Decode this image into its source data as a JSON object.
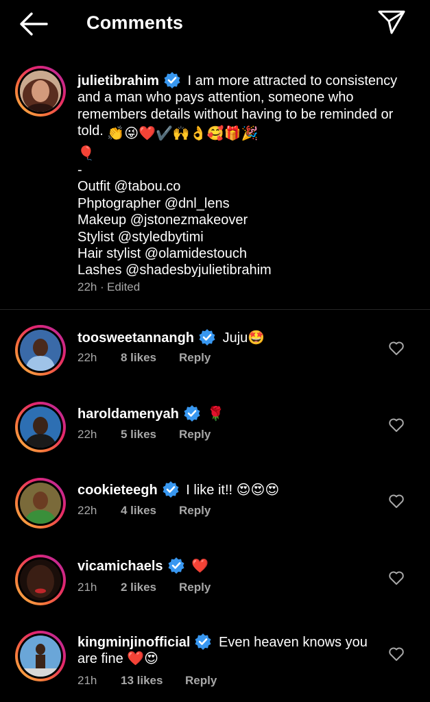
{
  "header": {
    "title": "Comments"
  },
  "caption": {
    "username": "julietibrahim",
    "text": "I am more attracted to consistency and a man who pays attention, someone who remembers details without having to be reminded or told.",
    "emojis": "👏😜❤️✔️🙌👌🥰🎁🎉",
    "emoji_line2": "🎈",
    "dash": "-",
    "credits": [
      "Outfit @tabou.co",
      "Phptographer @dnl_lens",
      "Makeup @jstonezmakeover",
      "Stylist @styledbytimi",
      "Hair stylist @olamidestouch",
      "Lashes @shadesbyjulietibrahim"
    ],
    "time": "22h",
    "separator": "·",
    "edited": "Edited"
  },
  "comments": [
    {
      "username": "toosweetannangh",
      "text": "Juju🤩",
      "time": "22h",
      "likes": "8 likes",
      "reply": "Reply"
    },
    {
      "username": "haroldamenyah",
      "text": "🌹",
      "time": "22h",
      "likes": "5 likes",
      "reply": "Reply"
    },
    {
      "username": "cookieteegh",
      "text": "I like it!! 😍😍😍",
      "time": "22h",
      "likes": "4 likes",
      "reply": "Reply"
    },
    {
      "username": "vicamichaels",
      "text": "❤️",
      "time": "21h",
      "likes": "2 likes",
      "reply": "Reply"
    },
    {
      "username": "kingminjinofficial",
      "text": "Even heaven knows you",
      "text_line2": "are fine ❤️😍",
      "time": "21h",
      "likes": "13 likes",
      "reply": "Reply"
    }
  ],
  "colors": {
    "background": "#000000",
    "meta": "#a8a8a8",
    "verified": "#3897f0",
    "heart": "#ed4956"
  },
  "icons": [
    "back-arrow-icon",
    "send-icon",
    "verified-badge-icon",
    "heart-outline-icon"
  ]
}
